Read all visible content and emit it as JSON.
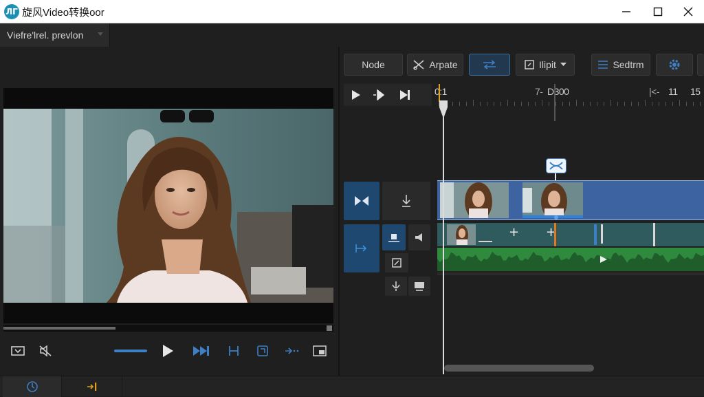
{
  "window": {
    "title": "旋风Video转换oor",
    "logo_text": "ЛГ",
    "controls": [
      "minimize-icon",
      "maximize-icon",
      "close-icon"
    ]
  },
  "preview_panel": {
    "tab_label": "Viefre'lrel. prevlon",
    "scrub_progress": 0.34
  },
  "player_controls": {
    "icons": [
      "caption-icon",
      "mute-icon",
      "volume-slider",
      "play-icon",
      "next-frame-icon",
      "mark-in-icon",
      "export-frame-icon",
      "fast-forward-icon",
      "pip-icon"
    ],
    "volume_level": 0.16
  },
  "status_tabs": [
    "clock-icon",
    "audio-split-icon"
  ],
  "toolbar": {
    "node_label": "Node",
    "arpate_label": "Arpate",
    "swap_icon": "swap-arrows-icon",
    "hipit_label": "Ilipit",
    "sedtrm_label": "Sedtrm",
    "settings_icon": "gear-icon"
  },
  "transport": [
    "play-icon",
    "step-forward-icon",
    "skip-end-icon"
  ],
  "ruler": {
    "labels": [
      "0:1",
      "D300",
      "11",
      "15"
    ],
    "prefix_glyphs": [
      "7-",
      "|<-"
    ]
  },
  "tracks": {
    "video_track_controls": [
      "split-icon",
      "download-icon"
    ],
    "audio_track_controls": [
      "trim-icon",
      "keyframe-icon",
      "speaker-icon",
      "edit-icon",
      "mic-icon",
      "subtitle-icon"
    ],
    "transition_icon": "transition-bowtie-icon",
    "add_markers": [
      "+",
      "+"
    ]
  },
  "colors": {
    "accent": "#3d7fc4",
    "video_track": "#3d64a0",
    "clip_track": "#2f5a5e",
    "audio_wave": "#2f8a3d",
    "playhead_marker": "#e07a22"
  }
}
